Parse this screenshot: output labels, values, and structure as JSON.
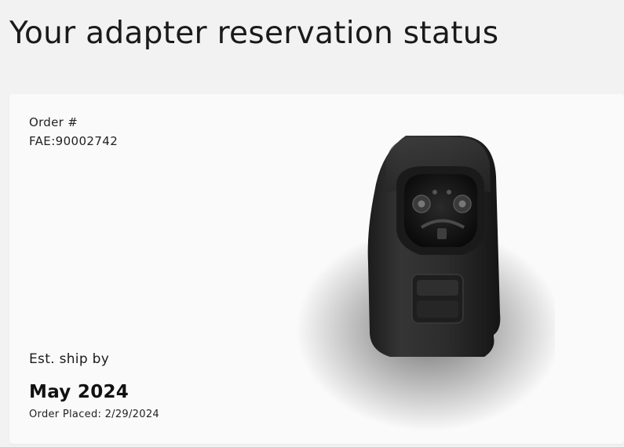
{
  "page": {
    "title": "Your adapter reservation status"
  },
  "order": {
    "label": "Order #",
    "number": "FAE:90002742",
    "ship_label": "Est. ship by",
    "ship_date": "May 2024",
    "placed_text": "Order Placed: 2/29/2024"
  },
  "product": {
    "icon": "adapter-product-image",
    "body_color": "#2e2e2e"
  }
}
